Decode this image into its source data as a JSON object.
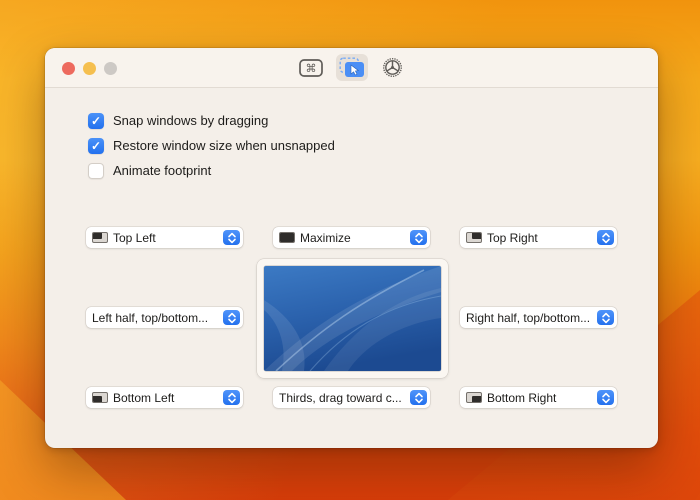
{
  "desktop": {
    "wallpaper": "orange-gradient",
    "top_color": "#f6a91b",
    "bottom_color": "#d93d09"
  },
  "window": {
    "traffic_lights": {
      "close": "#ed6a5e",
      "minimize": "#f5bf4f",
      "zoom_disabled": "#cdc9c5"
    },
    "toolbar": {
      "icons": [
        {
          "name": "keyboard-shortcuts-icon",
          "selected": false
        },
        {
          "name": "snap-areas-icon",
          "selected": true
        },
        {
          "name": "wheel-settings-icon",
          "selected": false
        }
      ]
    }
  },
  "checkboxes": [
    {
      "label": "Snap windows by dragging",
      "checked": true,
      "glyph": "✓"
    },
    {
      "label": "Restore window size when unsnapped",
      "checked": true,
      "glyph": "✓"
    },
    {
      "label": "Animate footprint",
      "checked": false,
      "glyph": ""
    }
  ],
  "snap_area_dropdowns": [
    {
      "position": "top-left",
      "label": "Top Left",
      "icon": "icon-top-left"
    },
    {
      "position": "top-center",
      "label": "Maximize",
      "icon": "icon-full"
    },
    {
      "position": "top-right",
      "label": "Top Right",
      "icon": "icon-top-right"
    },
    {
      "position": "middle-left",
      "label": "Left half, top/bottom...",
      "icon": ""
    },
    {
      "position": "middle-right",
      "label": "Right half, top/bottom...",
      "icon": ""
    },
    {
      "position": "bottom-left",
      "label": "Bottom Left",
      "icon": "icon-bottom-left"
    },
    {
      "position": "bottom-center",
      "label": "Thirds, drag toward c...",
      "icon": ""
    },
    {
      "position": "bottom-right",
      "label": "Bottom Right",
      "icon": "icon-bottom-right"
    }
  ],
  "accent": {
    "control_blue": "#2a7bf4",
    "checkbox_blue": "#2f7cf4"
  }
}
